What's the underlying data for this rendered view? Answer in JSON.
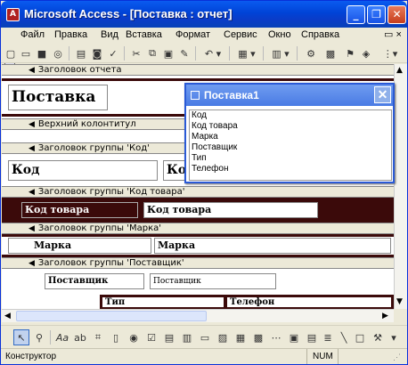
{
  "window": {
    "title": "Microsoft Access - [Поставка : отчет]"
  },
  "menu": [
    "Файл",
    "Правка",
    "Вид",
    "Вставка",
    "Формат",
    "Сервис",
    "Окно",
    "Справка"
  ],
  "report": {
    "sections": {
      "report_header": "Заголовок отчета",
      "page_header": "Верхний колонтитул",
      "group_kod": "Заголовок группы 'Код'",
      "group_kod_tovara": "Заголовок группы 'Код товара'",
      "group_marka": "Заголовок группы 'Марка'",
      "group_postavshik": "Заголовок группы 'Поставщик'"
    },
    "title_label": "Поставка",
    "kod_label": "Код",
    "kod_field": "Код",
    "kod_tovara_label": "Код товара",
    "kod_tovara_field": "Код товара",
    "marka_label": "Марка",
    "marka_field": "Марка",
    "postavshik_label": "Поставщик",
    "postavshik_field": "Поставщик",
    "tip_label": "Тип",
    "telefon_label": "Телефон"
  },
  "field_list": {
    "title": "Поставка1",
    "items": [
      "Код",
      "Код товара",
      "Марка",
      "Поставщик",
      "Тип",
      "Телефон"
    ]
  },
  "status": {
    "mode": "Конструктор",
    "num": "NUM"
  },
  "colors": {
    "band_dark": "#3b0a0a",
    "titlebar": "#0a5bf0"
  }
}
